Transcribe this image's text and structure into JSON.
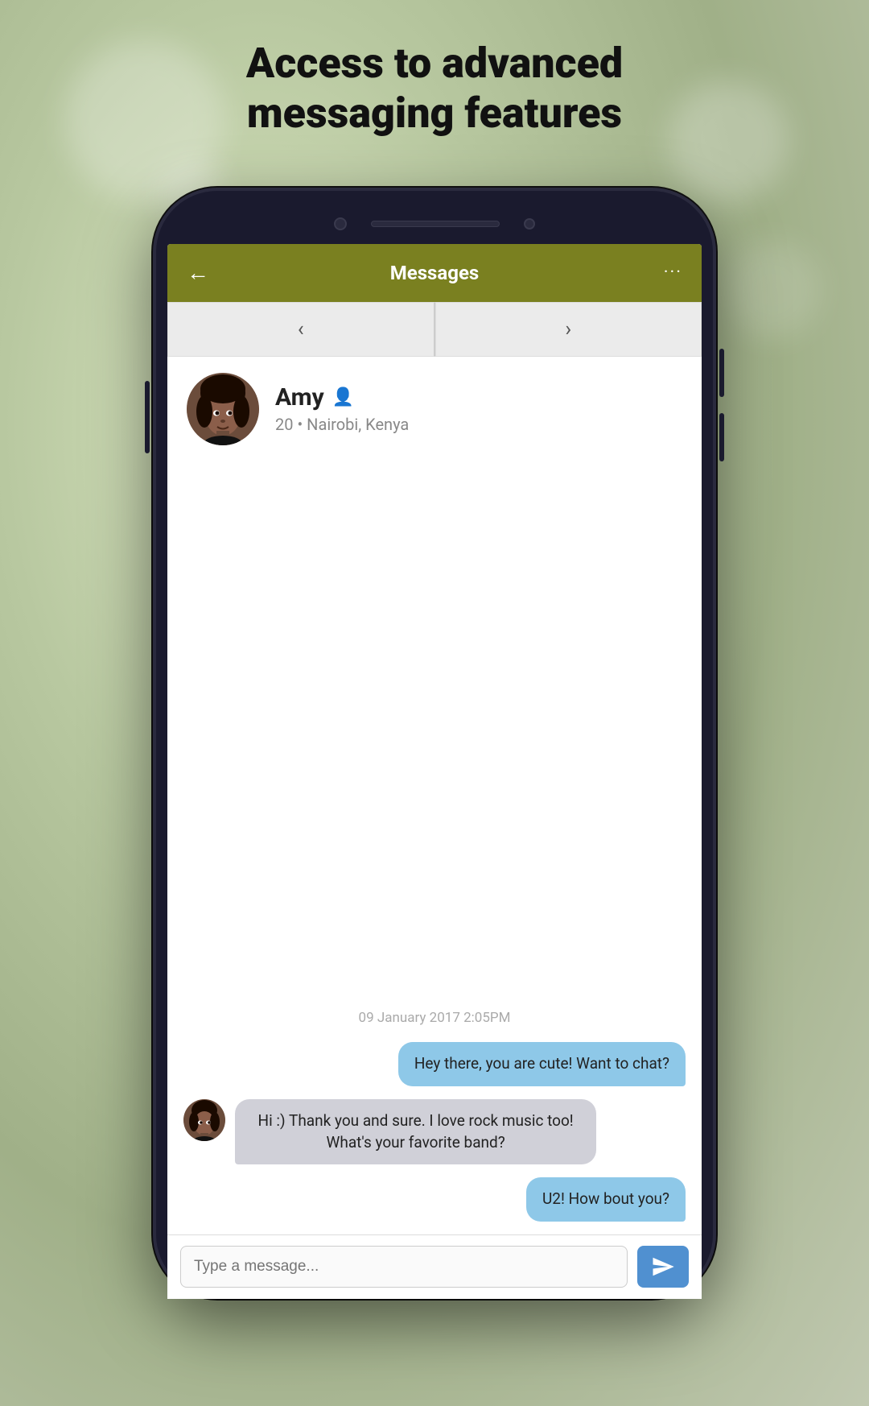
{
  "page": {
    "title_line1": "Access to advanced",
    "title_line2": "messaging features"
  },
  "header": {
    "back_label": "←",
    "title": "Messages",
    "more_label": "···"
  },
  "nav": {
    "prev_label": "‹",
    "next_label": "›"
  },
  "profile": {
    "name": "Amy",
    "age": "20",
    "dot": "•",
    "location": "Nairobi, Kenya"
  },
  "chat": {
    "timestamp": "09 January 2017 2:05PM",
    "messages": [
      {
        "type": "sent",
        "text": "Hey there, you are cute! Want to chat?"
      },
      {
        "type": "received",
        "text": "Hi :) Thank you and sure. I love rock music too! What's your favorite band?"
      },
      {
        "type": "sent",
        "text": "U2! How bout you?"
      }
    ]
  },
  "input": {
    "placeholder": "Type a message..."
  },
  "icons": {
    "back": "←",
    "more": "···",
    "prev": "‹",
    "next": "›",
    "person": "👤",
    "send": "send-icon"
  }
}
